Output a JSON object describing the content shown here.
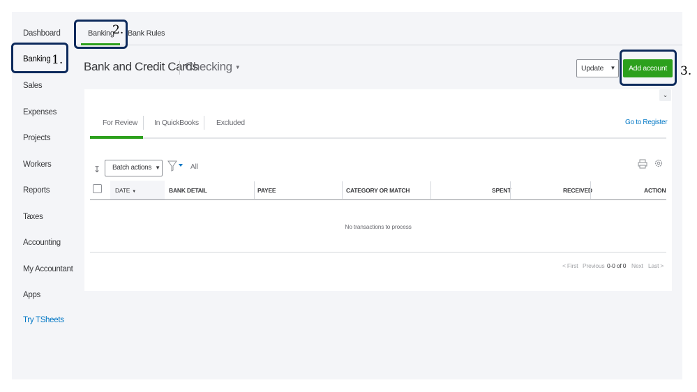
{
  "sidebar": {
    "items": [
      {
        "label": "Dashboard"
      },
      {
        "label": "Banking"
      },
      {
        "label": "Sales"
      },
      {
        "label": "Expenses"
      },
      {
        "label": "Projects"
      },
      {
        "label": "Workers"
      },
      {
        "label": "Reports"
      },
      {
        "label": "Taxes"
      },
      {
        "label": "Accounting"
      },
      {
        "label": "My Accountant"
      },
      {
        "label": "Apps"
      },
      {
        "label": "Try TSheets"
      }
    ]
  },
  "subtabs": [
    {
      "label": "Banking"
    },
    {
      "label": "Bank Rules"
    }
  ],
  "annotations": [
    "1.",
    "2.",
    "3."
  ],
  "header": {
    "title": "Bank and Credit Cards",
    "account": "Checking",
    "update_label": "Update",
    "add_account_label": "Add account"
  },
  "review_tabs": [
    {
      "label": "For Review"
    },
    {
      "label": "In QuickBooks"
    },
    {
      "label": "Excluded"
    }
  ],
  "go_to_register": "Go to Register",
  "toolbar": {
    "batch_actions": "Batch actions",
    "filter_value": "All"
  },
  "table": {
    "columns": [
      "DATE",
      "BANK DETAIL",
      "PAYEE",
      "CATEGORY OR MATCH",
      "SPENT",
      "RECEIVED",
      "ACTION"
    ],
    "empty_message": "No transactions to process"
  },
  "pagination": {
    "first": "< First",
    "previous": "Previous",
    "count": "0-0 of 0",
    "next": "Next",
    "last": "Last >"
  },
  "colors": {
    "accent_green": "#2ca01c",
    "link_blue": "#0077c5",
    "highlight_navy": "#0d2a5c"
  }
}
